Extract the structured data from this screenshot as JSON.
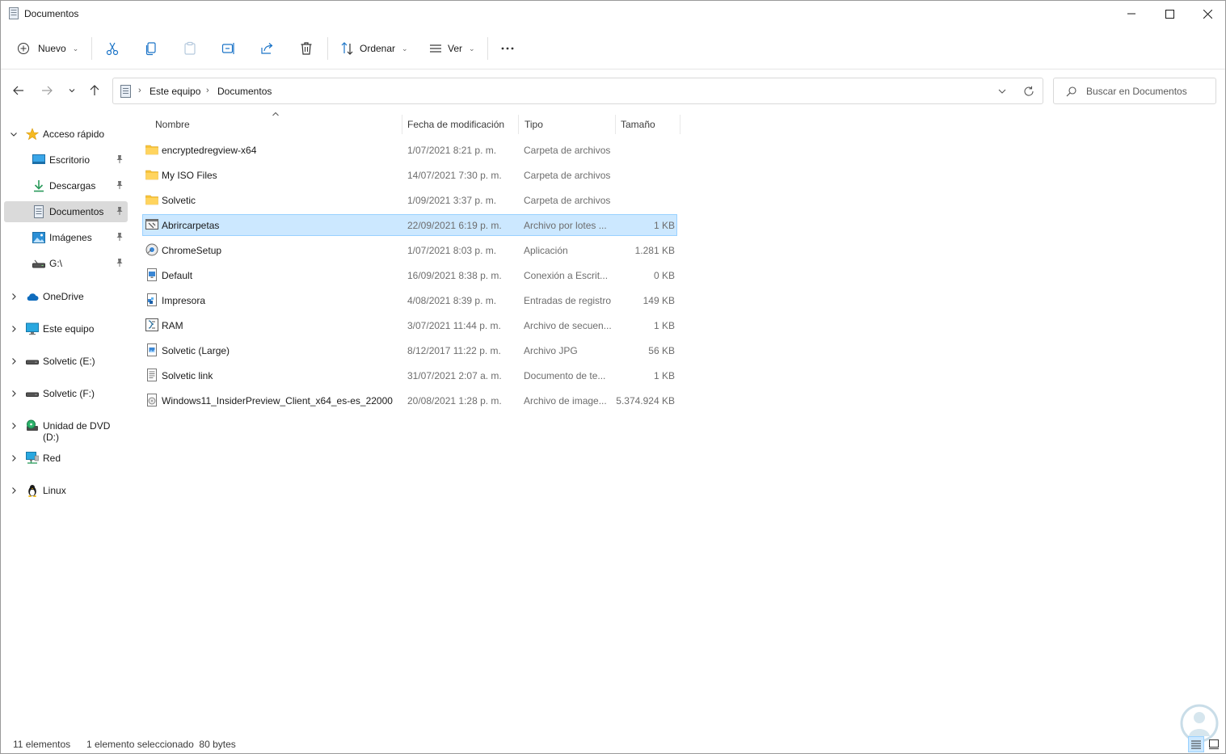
{
  "window": {
    "title": "Documentos",
    "icon": "document-icon"
  },
  "toolbar": {
    "new_label": "Nuevo",
    "sort_label": "Ordenar",
    "view_label": "Ver",
    "icons": [
      "plus-circle-icon",
      "cut-icon",
      "copy-icon",
      "paste-icon",
      "rename-icon",
      "share-icon",
      "delete-icon",
      "sort-icon",
      "view-icon",
      "more-icon"
    ]
  },
  "address": {
    "crumbs": [
      "Este equipo",
      "Documentos"
    ],
    "search_placeholder": "Buscar en Documentos"
  },
  "sidebar": {
    "quick_access": "Acceso rápido",
    "pinned": [
      {
        "label": "Escritorio",
        "icon": "desktop-icon"
      },
      {
        "label": "Descargas",
        "icon": "download-icon"
      },
      {
        "label": "Documentos",
        "icon": "documents-icon",
        "selected": true
      },
      {
        "label": "Imágenes",
        "icon": "pictures-icon"
      },
      {
        "label": "G:\\",
        "icon": "drive-icon"
      }
    ],
    "roots": [
      {
        "label": "OneDrive",
        "icon": "cloud-icon"
      },
      {
        "label": "Este equipo",
        "icon": "monitor-icon"
      },
      {
        "label": "Solvetic (E:)",
        "icon": "drive-icon"
      },
      {
        "label": "Solvetic (F:)",
        "icon": "drive-icon"
      },
      {
        "label": "Unidad de DVD (D:)",
        "icon": "dvd-icon"
      },
      {
        "label": "Red",
        "icon": "network-icon"
      },
      {
        "label": "Linux",
        "icon": "penguin-icon"
      }
    ]
  },
  "columns": {
    "name": "Nombre",
    "date": "Fecha de modificación",
    "type": "Tipo",
    "size": "Tamaño"
  },
  "files": [
    {
      "name": "encryptedregview-x64",
      "date": "1/07/2021 8:21 p. m.",
      "type": "Carpeta de archivos",
      "size": "",
      "icon": "folder-icon"
    },
    {
      "name": "My ISO Files",
      "date": "14/07/2021 7:30 p. m.",
      "type": "Carpeta de archivos",
      "size": "",
      "icon": "folder-icon"
    },
    {
      "name": "Solvetic",
      "date": "1/09/2021 3:37 p. m.",
      "type": "Carpeta de archivos",
      "size": "",
      "icon": "folder-icon"
    },
    {
      "name": "Abrircarpetas",
      "date": "22/09/2021 6:19 p. m.",
      "type": "Archivo por lotes ...",
      "size": "1 KB",
      "icon": "batch-file-icon",
      "selected": true
    },
    {
      "name": "ChromeSetup",
      "date": "1/07/2021 8:03 p. m.",
      "type": "Aplicación",
      "size": "1.281 KB",
      "icon": "installer-icon"
    },
    {
      "name": "Default",
      "date": "16/09/2021 8:38 p. m.",
      "type": "Conexión a Escrit...",
      "size": "0 KB",
      "icon": "remote-desktop-icon"
    },
    {
      "name": "Impresora",
      "date": "4/08/2021 8:39 p. m.",
      "type": "Entradas de registro",
      "size": "149 KB",
      "icon": "registry-file-icon"
    },
    {
      "name": "RAM",
      "date": "3/07/2021 11:44 p. m.",
      "type": "Archivo de secuen...",
      "size": "1 KB",
      "icon": "script-file-icon"
    },
    {
      "name": "Solvetic (Large)",
      "date": "8/12/2017 11:22 p. m.",
      "type": "Archivo JPG",
      "size": "56 KB",
      "icon": "image-file-icon"
    },
    {
      "name": "Solvetic link",
      "date": "31/07/2021 2:07 a. m.",
      "type": "Documento de te...",
      "size": "1 KB",
      "icon": "text-file-icon"
    },
    {
      "name": "Windows11_InsiderPreview_Client_x64_es-es_22000",
      "date": "20/08/2021 1:28 p. m.",
      "type": "Archivo de image...",
      "size": "5.374.924 KB",
      "icon": "disc-image-icon"
    }
  ],
  "status": {
    "count": "11 elementos",
    "selection": "1 elemento seleccionado  80 bytes"
  },
  "colors": {
    "selection_bg": "#cce8ff",
    "selection_border": "#99d1ff",
    "folder": "#f8c43a",
    "accent": "#0067c0"
  }
}
